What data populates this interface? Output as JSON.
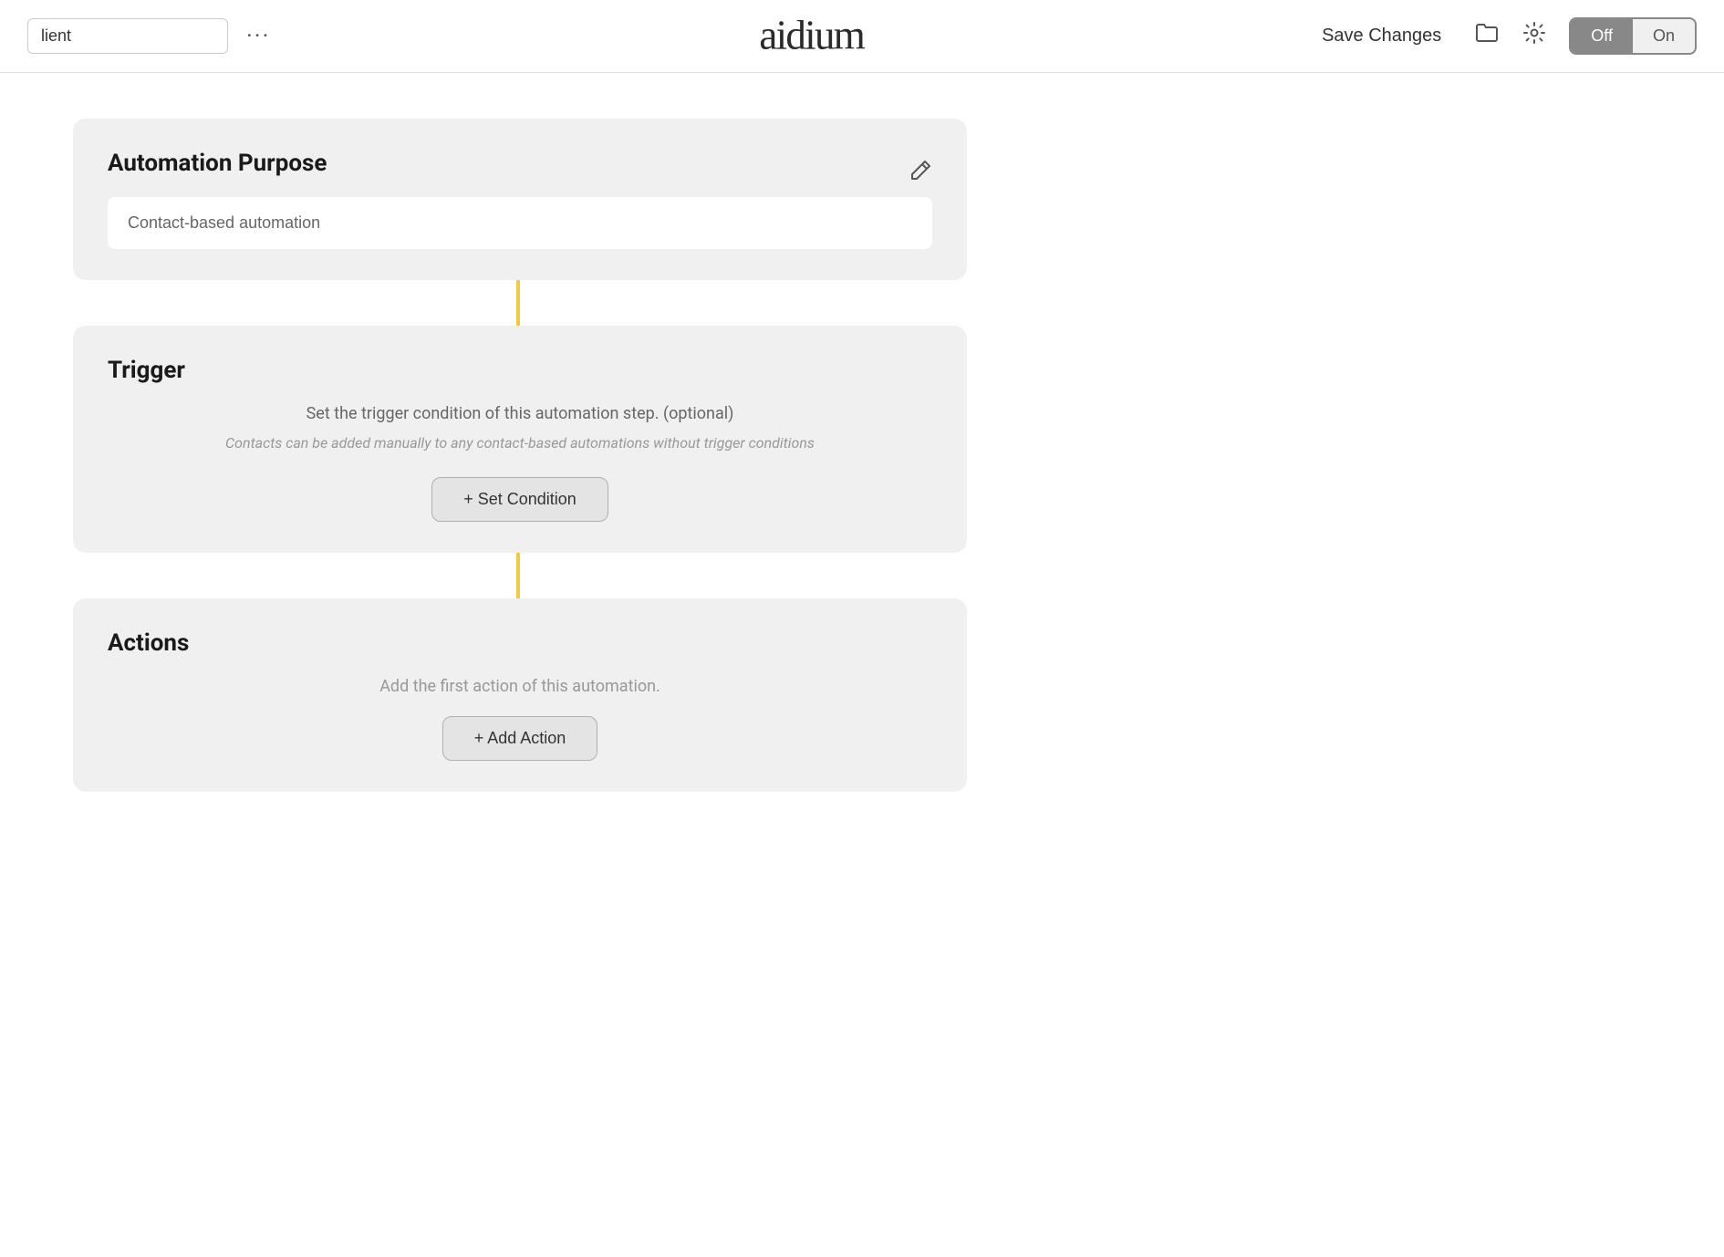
{
  "header": {
    "search_placeholder": "lient",
    "search_value": "lient",
    "dots_icon": "···",
    "save_changes_label": "Save Changes",
    "toggle": {
      "off_label": "Off",
      "on_label": "On",
      "active": "off"
    }
  },
  "logo": {
    "text": "aidium"
  },
  "automation_purpose": {
    "title": "Automation Purpose",
    "input_value": "Contact-based automation",
    "input_placeholder": "Contact-based automation"
  },
  "trigger": {
    "title": "Trigger",
    "description": "Set the trigger condition of this automation step. (optional)",
    "note": "Contacts can be added manually to any contact-based automations without trigger conditions",
    "set_condition_label": "+ Set Condition"
  },
  "actions": {
    "title": "Actions",
    "description": "Add the first action of this automation.",
    "add_action_label": "+ Add Action"
  }
}
